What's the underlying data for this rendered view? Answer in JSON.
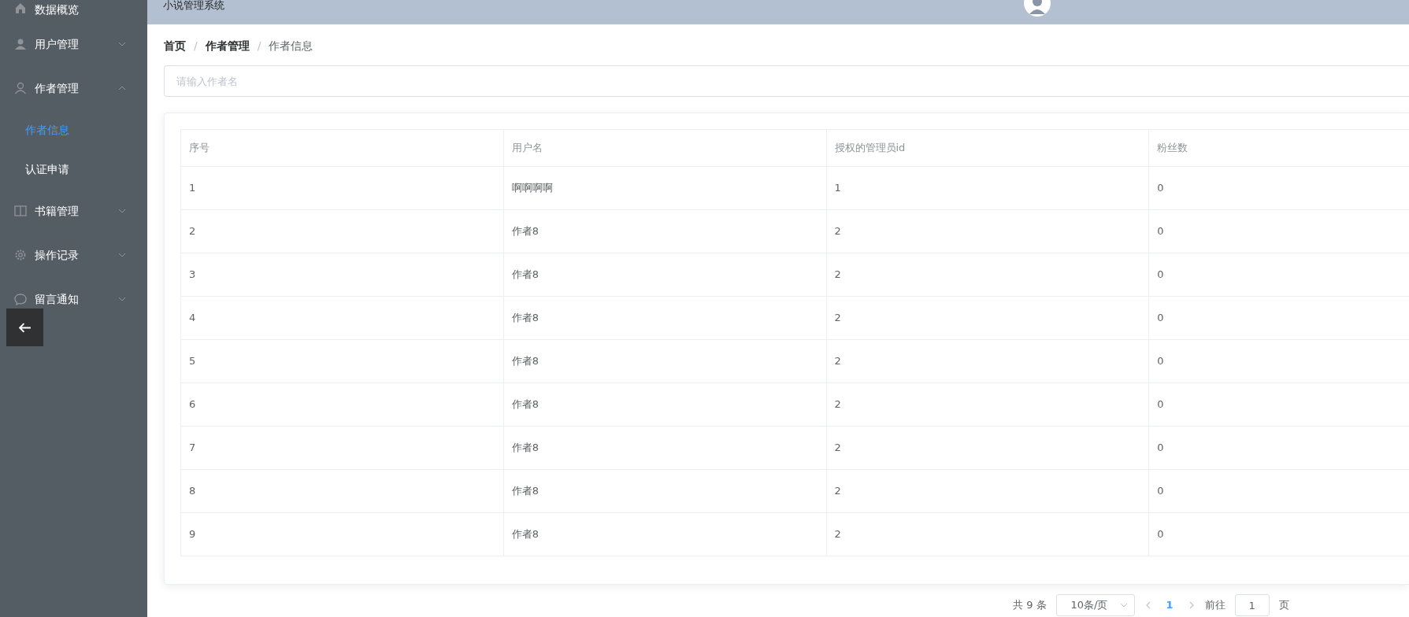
{
  "header": {
    "title": "小说管理系统"
  },
  "sidebar": {
    "items": [
      {
        "kind": "link",
        "label": "数据概览"
      },
      {
        "kind": "menu",
        "label": "用户管理",
        "expanded": false
      },
      {
        "kind": "menu",
        "label": "作者管理",
        "expanded": true,
        "children": [
          {
            "label": "作者信息",
            "selected": true
          },
          {
            "label": "认证申请",
            "selected": false
          }
        ]
      },
      {
        "kind": "menu",
        "label": "书籍管理",
        "expanded": false
      },
      {
        "kind": "menu",
        "label": "操作记录",
        "expanded": false
      },
      {
        "kind": "menu",
        "label": "留言通知",
        "expanded": false
      }
    ]
  },
  "breadcrumb": [
    {
      "kind": "link",
      "label": "首页",
      "current": false
    },
    {
      "kind": "separator",
      "label": "/"
    },
    {
      "kind": "link",
      "label": "作者管理",
      "current": false
    },
    {
      "kind": "separator",
      "label": "/"
    },
    {
      "kind": "link",
      "label": "作者信息",
      "current": true
    }
  ],
  "search": {
    "placeholder": "请输入作者名"
  },
  "table": {
    "columns": [
      "序号",
      "用户名",
      "授权的管理员id",
      "粉丝数"
    ],
    "rows": [
      [
        "1",
        "啊啊啊啊",
        "1",
        "0"
      ],
      [
        "2",
        "作者8",
        "2",
        "0"
      ],
      [
        "3",
        "作者8",
        "2",
        "0"
      ],
      [
        "4",
        "作者8",
        "2",
        "0"
      ],
      [
        "5",
        "作者8",
        "2",
        "0"
      ],
      [
        "6",
        "作者8",
        "2",
        "0"
      ],
      [
        "7",
        "作者8",
        "2",
        "0"
      ],
      [
        "8",
        "作者8",
        "2",
        "0"
      ],
      [
        "9",
        "作者8",
        "2",
        "0"
      ]
    ]
  },
  "pagination": {
    "total": "共 9 条",
    "page_size": "10条/页",
    "pages": [
      {
        "label": "1",
        "selected": true
      }
    ],
    "goto_label": "前往",
    "goto_value": "1",
    "goto_unit": "页"
  }
}
